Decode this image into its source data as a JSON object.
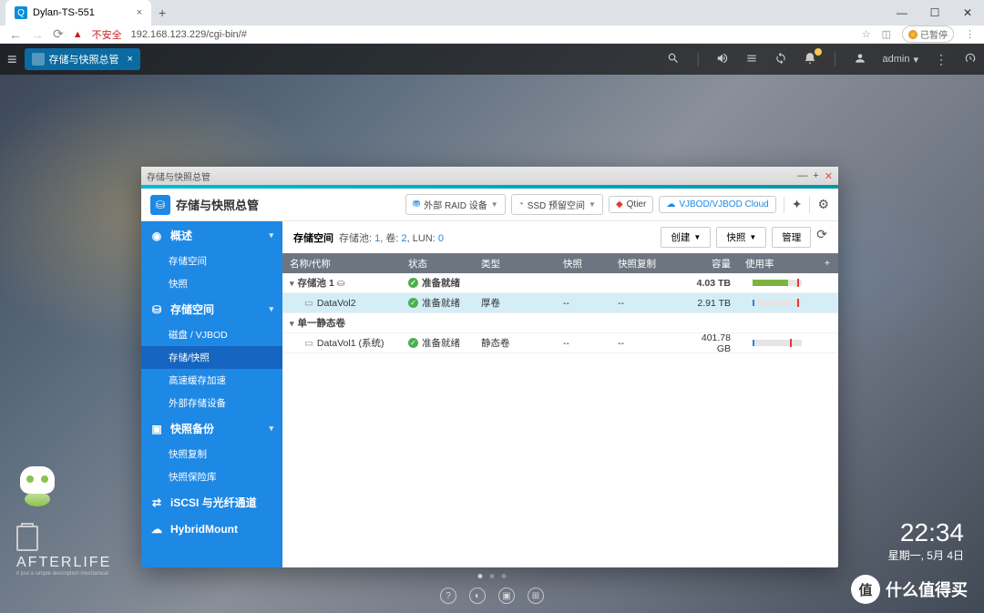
{
  "browser": {
    "tab_title": "Dylan-TS-551",
    "security_text": "不安全",
    "url": "192.168.123.229/cgi-bin/#",
    "ext_label": "已暂停"
  },
  "nas_topbar": {
    "app_tab": "存储与快照总管",
    "admin": "admin"
  },
  "window": {
    "title_small": "存储与快照总管",
    "title": "存储与快照总管",
    "toolbar": {
      "raid": "外部 RAID 设备",
      "ssd": "SSD 预留空间",
      "qtier": "Qtier",
      "vjbod": "VJBOD/VJBOD Cloud"
    }
  },
  "sidebar": {
    "overview": "概述",
    "overview_items": [
      "存储空间",
      "快照"
    ],
    "storage": "存储空间",
    "storage_items": [
      "磁盘 / VJBOD",
      "存储/快照",
      "高速缓存加速",
      "外部存储设备"
    ],
    "snapshot": "快照备份",
    "snapshot_items": [
      "快照复制",
      "快照保险库"
    ],
    "iscsi": "iSCSI 与光纤通道",
    "hybrid": "HybridMount"
  },
  "main": {
    "header_label": "存储空间",
    "pool_label": "存储池:",
    "pool_count": "1",
    "vol_label": "卷:",
    "vol_count": "2",
    "lun_label": "LUN:",
    "lun_count": "0",
    "btn_create": "创建",
    "btn_snapshot": "快照",
    "btn_manage": "管理",
    "columns": {
      "name": "名称/代称",
      "status": "状态",
      "type": "类型",
      "snapshot": "快照",
      "replication": "快照复制",
      "capacity": "容量",
      "usage": "使用率"
    },
    "rows": {
      "pool1": {
        "name": "存储池 1",
        "status": "准备就绪",
        "capacity": "4.03 TB"
      },
      "datavol2": {
        "name": "DataVol2",
        "status": "准备就绪",
        "type": "厚卷",
        "snapshot": "--",
        "replication": "--",
        "capacity": "2.91 TB"
      },
      "static_group": {
        "name": "单一静态卷"
      },
      "datavol1": {
        "name": "DataVol1 (系统)",
        "status": "准备就绪",
        "type": "静态卷",
        "snapshot": "--",
        "replication": "--",
        "capacity": "401.78 GB"
      }
    }
  },
  "clock": {
    "time": "22:34",
    "date": "星期一, 5月 4日"
  },
  "logo": {
    "text": "AFTERLIFE"
  },
  "watermark": {
    "badge": "值",
    "text": "什么值得买"
  }
}
